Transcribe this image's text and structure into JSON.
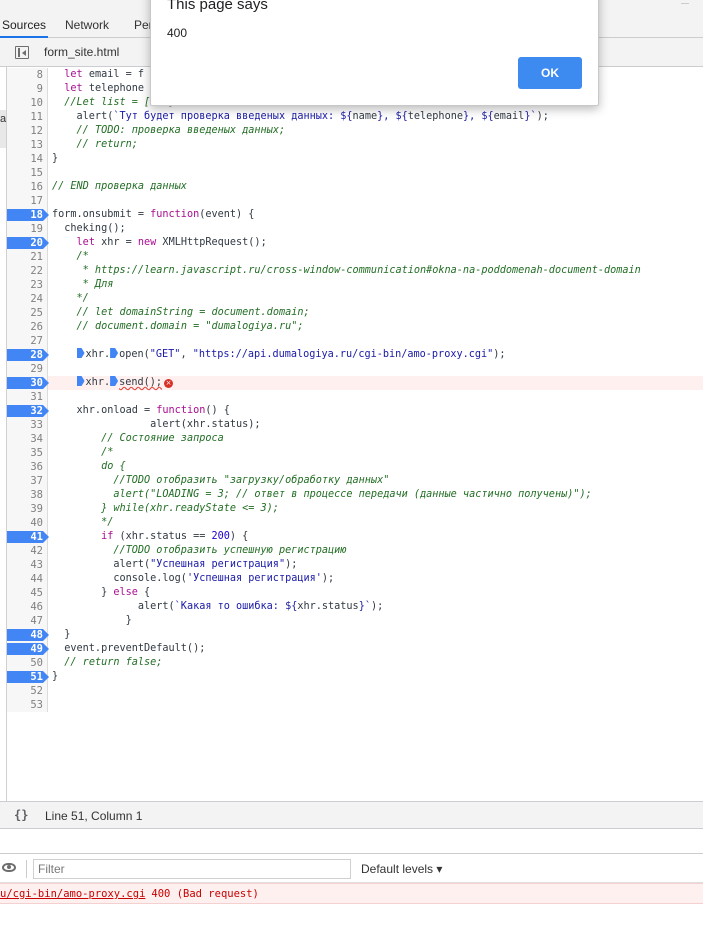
{
  "devtools": {
    "tabs": [
      {
        "label": "Sources"
      },
      {
        "label": "Network"
      },
      {
        "label": "Per"
      }
    ],
    "file_tab": "form_site.html",
    "nav_letter": "a"
  },
  "code": {
    "lines": [
      {
        "n": "8",
        "bp": false,
        "html": "  <span class=\"c-kw\">let</span> email = f"
      },
      {
        "n": "9",
        "bp": false,
        "html": "  <span class=\"c-kw\">let</span> telephone"
      },
      {
        "n": "10",
        "bp": false,
        "html": "  <span class=\"c-comment\">//Let list = [...]</span>"
      },
      {
        "n": "11",
        "bp": false,
        "html": "    alert(<span class=\"c-str\">`Тут будет проверка введеных данных: ${</span>name<span class=\"c-str\">}, ${</span>telephone<span class=\"c-str\">}, ${</span>email<span class=\"c-str\">}`</span>);"
      },
      {
        "n": "12",
        "bp": false,
        "html": "    <span class=\"c-comment\">// TODO: проверка введеных данных;</span>"
      },
      {
        "n": "13",
        "bp": false,
        "html": "    <span class=\"c-comment\">// return;</span>"
      },
      {
        "n": "14",
        "bp": false,
        "html": "}"
      },
      {
        "n": "15",
        "bp": false,
        "html": ""
      },
      {
        "n": "16",
        "bp": false,
        "html": "<span class=\"c-comment\">// END проверка данных</span>"
      },
      {
        "n": "17",
        "bp": false,
        "html": ""
      },
      {
        "n": "18",
        "bp": true,
        "html": "form.onsubmit = <span class=\"c-kw\">function</span>(event) {"
      },
      {
        "n": "19",
        "bp": false,
        "html": "  cheking();"
      },
      {
        "n": "20",
        "bp": true,
        "html": "    <span class=\"c-kw\">let</span> xhr = <span class=\"c-kw\">new</span> XMLHttpRequest();"
      },
      {
        "n": "21",
        "bp": false,
        "html": "    <span class=\"c-comment\">/*</span>"
      },
      {
        "n": "22",
        "bp": false,
        "html": "<span class=\"c-comment\">     * https://learn.javascript.ru/cross-window-communication#okna-na-poddomenah-document-domain</span>"
      },
      {
        "n": "23",
        "bp": false,
        "html": "<span class=\"c-comment\">     * Для</span>"
      },
      {
        "n": "24",
        "bp": false,
        "html": "<span class=\"c-comment\">    */</span>"
      },
      {
        "n": "25",
        "bp": false,
        "html": "    <span class=\"c-comment\">// let domainString = document.domain;</span>"
      },
      {
        "n": "26",
        "bp": false,
        "html": "    <span class=\"c-comment\">// document.domain = \"dumalogiya.ru\";</span>"
      },
      {
        "n": "27",
        "bp": false,
        "html": ""
      },
      {
        "n": "28",
        "bp": true,
        "html": "    <span class=\"inl-bp\"></span>xhr.<span class=\"inl-bp\"></span>open(<span class=\"c-str\">\"GET\"</span>, <span class=\"c-str\">\"https://api.dumalogiya.ru/cgi-bin/amo-proxy.cgi\"</span>);"
      },
      {
        "n": "29",
        "bp": false,
        "html": ""
      },
      {
        "n": "30",
        "bp": true,
        "error": true,
        "html": "    <span class=\"inl-bp\"></span>xhr.<span class=\"inl-bp\"></span><span class=\"err-underline\">send();</span><span class=\"err-icon\">×</span>"
      },
      {
        "n": "31",
        "bp": false,
        "html": ""
      },
      {
        "n": "32",
        "bp": true,
        "html": "    xhr.onload = <span class=\"c-kw\">function</span>() {"
      },
      {
        "n": "33",
        "bp": false,
        "html": "                alert(xhr.status);"
      },
      {
        "n": "34",
        "bp": false,
        "html": "        <span class=\"c-comment\">// Состояние запроса</span>"
      },
      {
        "n": "35",
        "bp": false,
        "html": "        <span class=\"c-comment\">/*</span>"
      },
      {
        "n": "36",
        "bp": false,
        "html": "<span class=\"c-comment\">        do {</span>"
      },
      {
        "n": "37",
        "bp": false,
        "html": "<span class=\"c-comment\">          //TODO отобразить \"загрузку/обработку данных\"</span>"
      },
      {
        "n": "38",
        "bp": false,
        "html": "<span class=\"c-comment\">          alert(\"LOADING = 3; // ответ в процессе передачи (данные частично получены)\");</span>"
      },
      {
        "n": "39",
        "bp": false,
        "html": "<span class=\"c-comment\">        } while(xhr.readyState &lt;= 3);</span>"
      },
      {
        "n": "40",
        "bp": false,
        "html": "<span class=\"c-comment\">        */</span>"
      },
      {
        "n": "41",
        "bp": true,
        "html": "        <span class=\"c-kw\">if</span> (xhr.status == <span class=\"c-num\">200</span>) {"
      },
      {
        "n": "42",
        "bp": false,
        "html": "          <span class=\"c-comment\">//TODO отобразить успешную регистрацию</span>"
      },
      {
        "n": "43",
        "bp": false,
        "html": "          alert(<span class=\"c-str\">\"Успешная регистрация\"</span>);"
      },
      {
        "n": "44",
        "bp": false,
        "html": "          console.log(<span class=\"c-str\">'Успешная регистрация'</span>);"
      },
      {
        "n": "45",
        "bp": false,
        "html": "        } <span class=\"c-kw\">else</span> {"
      },
      {
        "n": "46",
        "bp": false,
        "html": "              alert(<span class=\"c-str\">`Какая то ошибка: ${</span>xhr.status<span class=\"c-str\">}`</span>);"
      },
      {
        "n": "47",
        "bp": false,
        "html": "            }"
      },
      {
        "n": "48",
        "bp": true,
        "html": "  }"
      },
      {
        "n": "49",
        "bp": true,
        "html": "  event.preventDefault();"
      },
      {
        "n": "50",
        "bp": false,
        "html": "  <span class=\"c-comment\">// return false;</span>"
      },
      {
        "n": "51",
        "bp": true,
        "html": "}"
      },
      {
        "n": "52",
        "bp": false,
        "html": ""
      },
      {
        "n": "53",
        "bp": false,
        "html": ""
      }
    ]
  },
  "status_bar": {
    "braces": "{}",
    "cursor": "Line 51, Column 1"
  },
  "console": {
    "filter_placeholder": "Filter",
    "levels": "Default levels ▾",
    "error_link": "u/cgi-bin/amo-proxy.cgi",
    "error_msg": "400 (Bad request)"
  },
  "dialog": {
    "title": "This page says",
    "message": "400",
    "ok_label": "OK"
  },
  "colors": {
    "breakpoint": "#4285f4",
    "ok_button": "#3d8bf0",
    "error_text": "#c80000"
  }
}
